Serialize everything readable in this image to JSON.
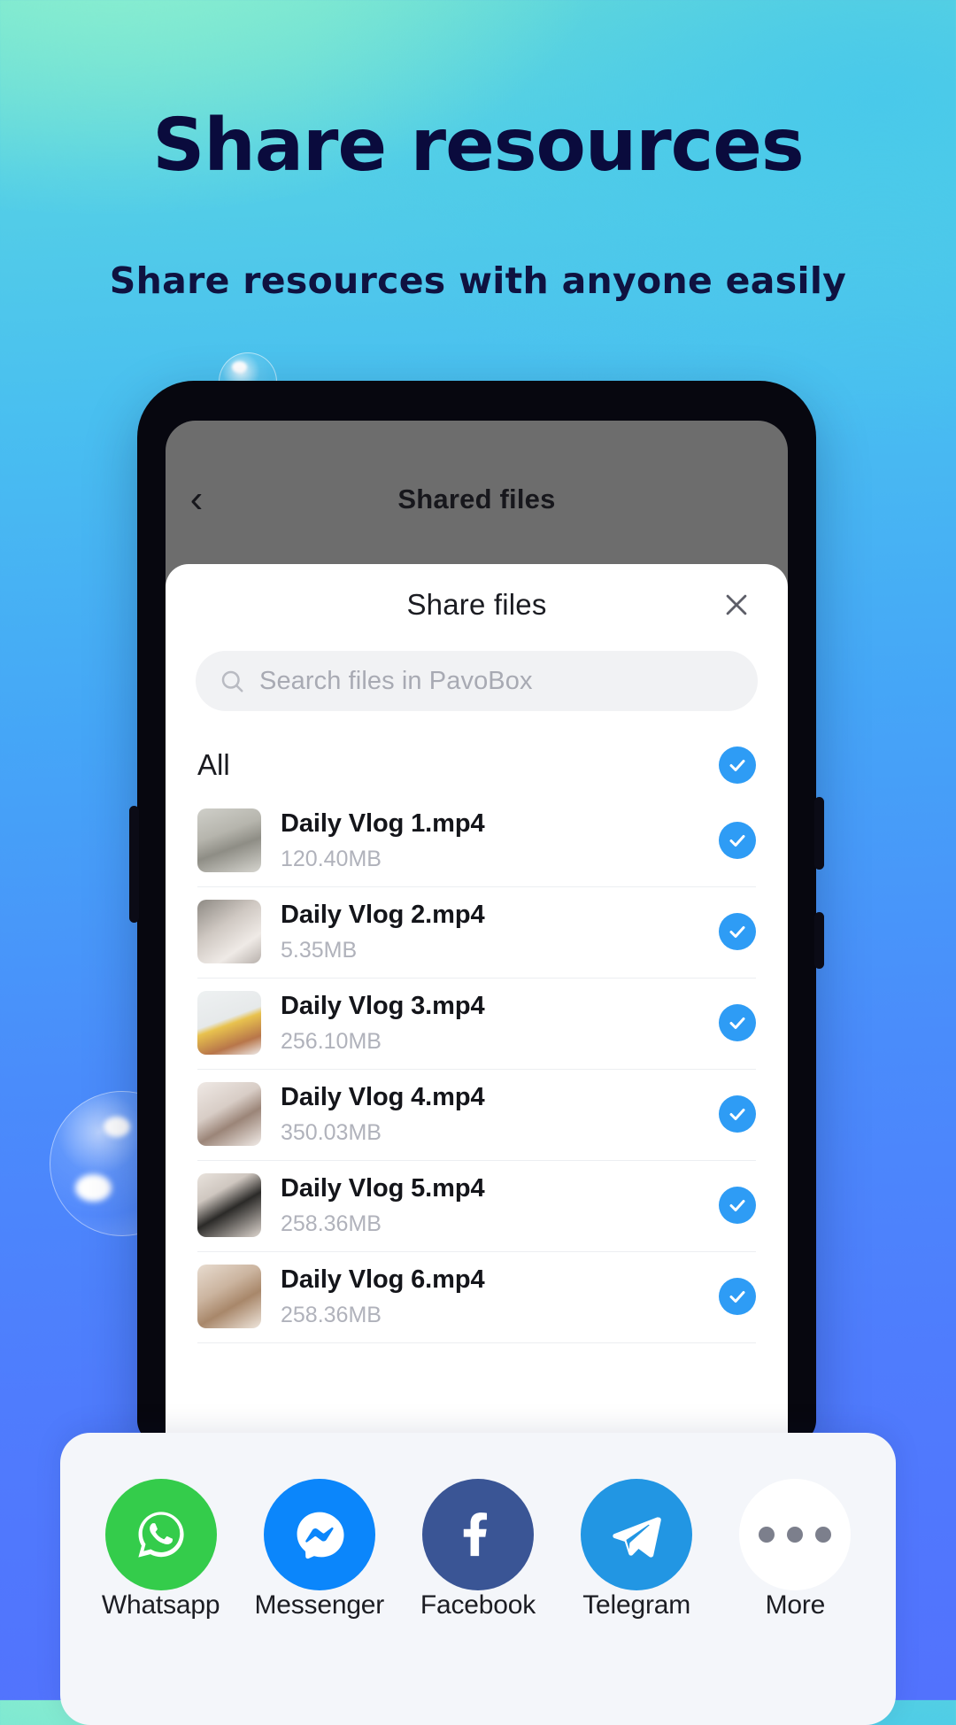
{
  "hero": {
    "title": "Share resources",
    "subtitle": "Share resources with anyone easily"
  },
  "colors": {
    "accent_blue": "#2e9cf5",
    "title_navy": "#0a0b3d",
    "whatsapp_green": "#34cc4b",
    "messenger_blue": "#0b86fb",
    "facebook_blue": "#3a5595",
    "telegram_blue": "#2296e3"
  },
  "phone": {
    "appbar": {
      "back_icon": "chevron-left-icon",
      "title": "Shared files"
    },
    "sheet": {
      "title": "Share files",
      "close_icon": "close-icon",
      "search": {
        "icon": "search-icon",
        "placeholder": "Search files in PavoBox",
        "value": ""
      },
      "select_all": {
        "label": "All",
        "checked": true,
        "check_icon": "check-circle-icon"
      },
      "files": [
        {
          "name": "Daily Vlog 1.mp4",
          "size": "120.40MB",
          "checked": true,
          "thumb": "statue-bull-head"
        },
        {
          "name": "Daily Vlog 2.mp4",
          "size": "5.35MB",
          "checked": true,
          "thumb": "draped-fabric"
        },
        {
          "name": "Daily Vlog 3.mp4",
          "size": "256.10MB",
          "checked": true,
          "thumb": "banana-on-table"
        },
        {
          "name": "Daily Vlog 4.mp4",
          "size": "350.03MB",
          "checked": true,
          "thumb": "framed-picture"
        },
        {
          "name": "Daily Vlog 5.mp4",
          "size": "258.36MB",
          "checked": true,
          "thumb": "camera-strap"
        },
        {
          "name": "Daily Vlog 6.mp4",
          "size": "258.36MB",
          "checked": true,
          "thumb": "plant-corridor"
        }
      ]
    }
  },
  "share_tray": {
    "items": [
      {
        "label": "Whatsapp",
        "icon": "whatsapp-icon"
      },
      {
        "label": "Messenger",
        "icon": "messenger-icon"
      },
      {
        "label": "Facebook",
        "icon": "facebook-icon"
      },
      {
        "label": "Telegram",
        "icon": "telegram-icon"
      },
      {
        "label": "More",
        "icon": "more-dots-icon"
      }
    ]
  }
}
